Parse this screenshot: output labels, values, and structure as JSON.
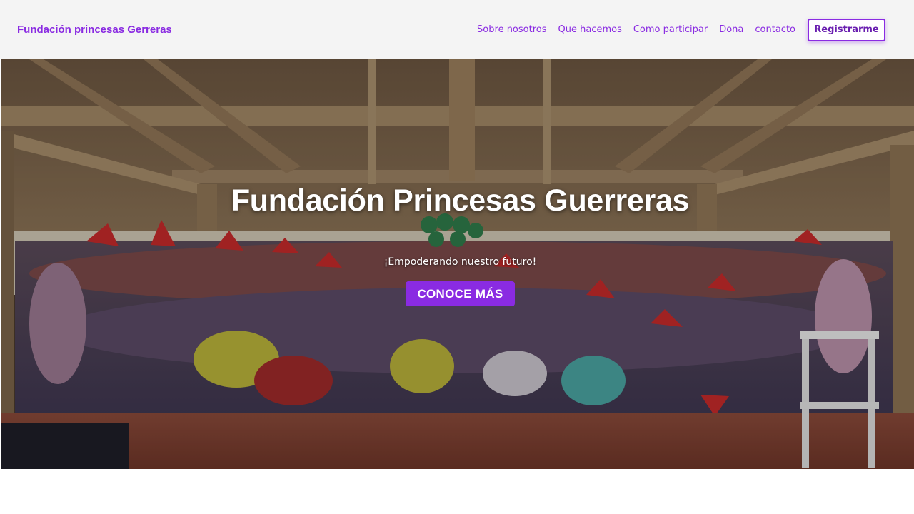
{
  "colors": {
    "accent": "#8a2be2",
    "navbar_bg": "#f4f4f4",
    "hero_text": "#ffffff"
  },
  "navbar": {
    "brand": "Fundación princesas Gerreras",
    "links": [
      "Sobre nosotros",
      "Que hacemos",
      "Como participar",
      "Dona",
      "contacto"
    ],
    "register_label": "Registrarme"
  },
  "hero": {
    "image_alt": "group-photo-under-thatched-roof",
    "title": "Fundación Princesas Guerreras",
    "subtitle": "¡Empoderando nuestro futuro!",
    "cta_label": "CONOCE MÁS"
  }
}
